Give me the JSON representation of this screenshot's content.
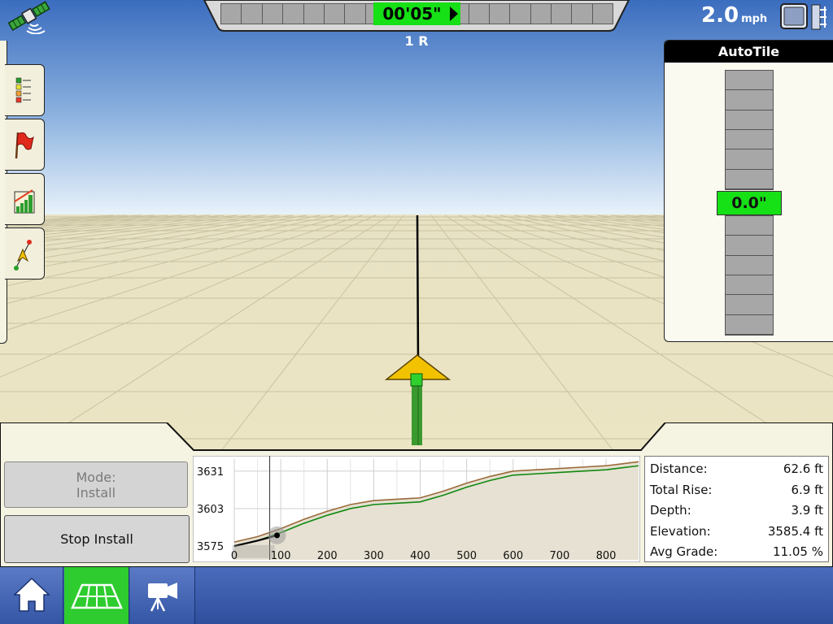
{
  "status": {
    "speed_value": "2.0",
    "speed_unit": "mph"
  },
  "lightbar": {
    "readout": "00'05\"",
    "pass_label": "1 R",
    "readout_color": "#16e016"
  },
  "autotile": {
    "title": "AutoTile",
    "readout": "0.0\""
  },
  "install": {
    "mode_line1": "Mode:",
    "mode_line2": "Install",
    "stop_label": "Stop Install"
  },
  "stats": [
    {
      "label": "Distance:",
      "value": "62.6 ft"
    },
    {
      "label": "Total Rise:",
      "value": "6.9 ft"
    },
    {
      "label": "Depth:",
      "value": "3.9 ft"
    },
    {
      "label": "Elevation:",
      "value": "3585.4 ft"
    },
    {
      "label": "Avg Grade:",
      "value": "11.05 %"
    }
  ],
  "chart_data": {
    "type": "line",
    "title": "",
    "xlabel": "",
    "ylabel": "",
    "x_ticks": [
      "0",
      "100",
      "200",
      "300",
      "400",
      "500",
      "600",
      "700",
      "800"
    ],
    "y_ticks": [
      "3631",
      "3603",
      "3575"
    ],
    "xlim": [
      0,
      870
    ],
    "ylim": [
      3572,
      3640
    ],
    "grid": true,
    "current_position": {
      "x": 92,
      "y": 3583
    },
    "series": [
      {
        "color": "#9a6a3a",
        "x": [
          0,
          50,
          100,
          150,
          200,
          250,
          300,
          350,
          400,
          450,
          500,
          550,
          600,
          650,
          700,
          750,
          800,
          870
        ],
        "y": [
          3578,
          3582,
          3588,
          3595,
          3601,
          3606,
          3609,
          3610,
          3611,
          3616,
          3622,
          3627,
          3631,
          3632,
          3633,
          3634,
          3635,
          3638
        ]
      },
      {
        "color": "#118811",
        "x": [
          0,
          50,
          100,
          150,
          200,
          250,
          300,
          350,
          400,
          450,
          500,
          550,
          600,
          650,
          700,
          750,
          800,
          870
        ],
        "y": [
          3575,
          3579,
          3585,
          3592,
          3598,
          3603,
          3606,
          3607,
          3608,
          3613,
          3619,
          3624,
          3628,
          3629,
          3630,
          3631,
          3632,
          3635
        ]
      }
    ]
  },
  "colors": {
    "accent_green": "#2ecc2e",
    "nav_blue": "#3557a6",
    "field": "#ebe5c3",
    "machine_yellow": "#f2c200"
  }
}
